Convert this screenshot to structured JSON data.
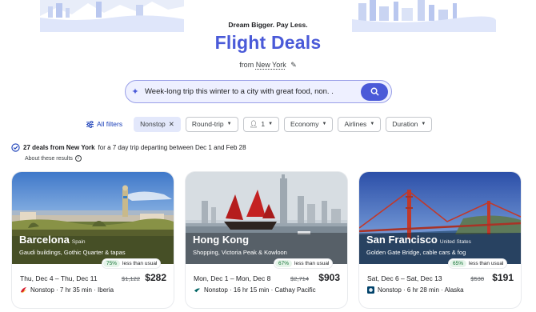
{
  "hero": {
    "tagline": "Dream Bigger. Pay Less.",
    "title": "Flight Deals",
    "from_prefix": "from",
    "from_city": "New York"
  },
  "search": {
    "query": "Week-long trip this winter to a city with great food, non. .",
    "accent": "#4a5ad8"
  },
  "filters": {
    "all_filters": "All filters",
    "nonstop": "Nonstop",
    "trip_type": "Round-trip",
    "passengers": "1",
    "cabin": "Economy",
    "airlines": "Airlines",
    "duration": "Duration"
  },
  "summary": {
    "count": "27 deals from New York",
    "rest": "for a 7 day trip departing between Dec 1 and Feb 28",
    "about": "About these results"
  },
  "cards": [
    {
      "city": "Barcelona",
      "country": "Spain",
      "subtitle": "Gaudi buildings, Gothic Quarter & tapas",
      "pct": "75%",
      "less_label": "less than usual",
      "dates": "Thu, Dec 4 – Thu, Dec 11",
      "old_price": "$1,122",
      "price": "$282",
      "flight": "Nonstop · 7 hr 35 min · Iberia"
    },
    {
      "city": "Hong Kong",
      "country": "",
      "subtitle": "Shopping, Victoria Peak & Kowloon",
      "pct": "67%",
      "less_label": "less than usual",
      "dates": "Mon, Dec 1 – Mon, Dec 8",
      "old_price": "$2,714",
      "price": "$903",
      "flight": "Nonstop · 16 hr 15 min · Cathay Pacific"
    },
    {
      "city": "San Francisco",
      "country": "United States",
      "subtitle": "Golden Gate Bridge, cable cars & fog",
      "pct": "65%",
      "less_label": "less than usual",
      "dates": "Sat, Dec 6 – Sat, Dec 13",
      "old_price": "$538",
      "price": "$191",
      "flight": "Nonstop · 6 hr 28 min · Alaska"
    }
  ]
}
